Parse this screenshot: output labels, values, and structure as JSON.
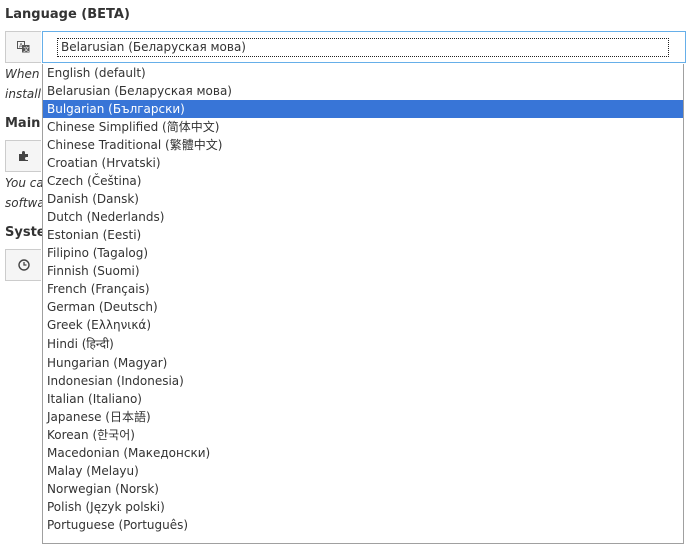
{
  "language": {
    "label": "Language (BETA)",
    "selected_value": "Belarusian (Беларуская мова)",
    "options": [
      {
        "label": "English (default)"
      },
      {
        "label": "Belarusian (Беларуская мова)"
      },
      {
        "label": "Bulgarian (Български)",
        "highlighted": true
      },
      {
        "label": "Chinese Simplified (简体中文)"
      },
      {
        "label": "Chinese Traditional (繁體中文)"
      },
      {
        "label": "Croatian (Hrvatski)"
      },
      {
        "label": "Czech (Čeština)"
      },
      {
        "label": "Danish (Dansk)"
      },
      {
        "label": "Dutch (Nederlands)"
      },
      {
        "label": "Estonian (Eesti)"
      },
      {
        "label": "Filipino (Tagalog)"
      },
      {
        "label": "Finnish (Suomi)"
      },
      {
        "label": "French (Français)"
      },
      {
        "label": "German (Deutsch)"
      },
      {
        "label": "Greek (Ελληνικά)"
      },
      {
        "label": "Hindi (हिन्दी)",
        "tall": true
      },
      {
        "label": "Hungarian (Magyar)"
      },
      {
        "label": "Indonesian (Indonesia)"
      },
      {
        "label": "Italian (Italiano)"
      },
      {
        "label": "Japanese (日本語)"
      },
      {
        "label": "Korean (한국어)"
      },
      {
        "label": "Macedonian (Македонски)"
      },
      {
        "label": "Malay (Melayu)"
      },
      {
        "label": "Norwegian (Norsk)"
      },
      {
        "label": "Polish (Język polski)"
      },
      {
        "label": "Portuguese (Português)"
      }
    ]
  },
  "language_help": {
    "line1": "When",
    "line2": "install"
  },
  "main": {
    "label": "Main"
  },
  "main_help": {
    "line1": "You ca",
    "line2": "softwa"
  },
  "system": {
    "label": "Syster"
  },
  "colors": {
    "accent": "#3875d7",
    "focus_border": "#66afe9"
  }
}
